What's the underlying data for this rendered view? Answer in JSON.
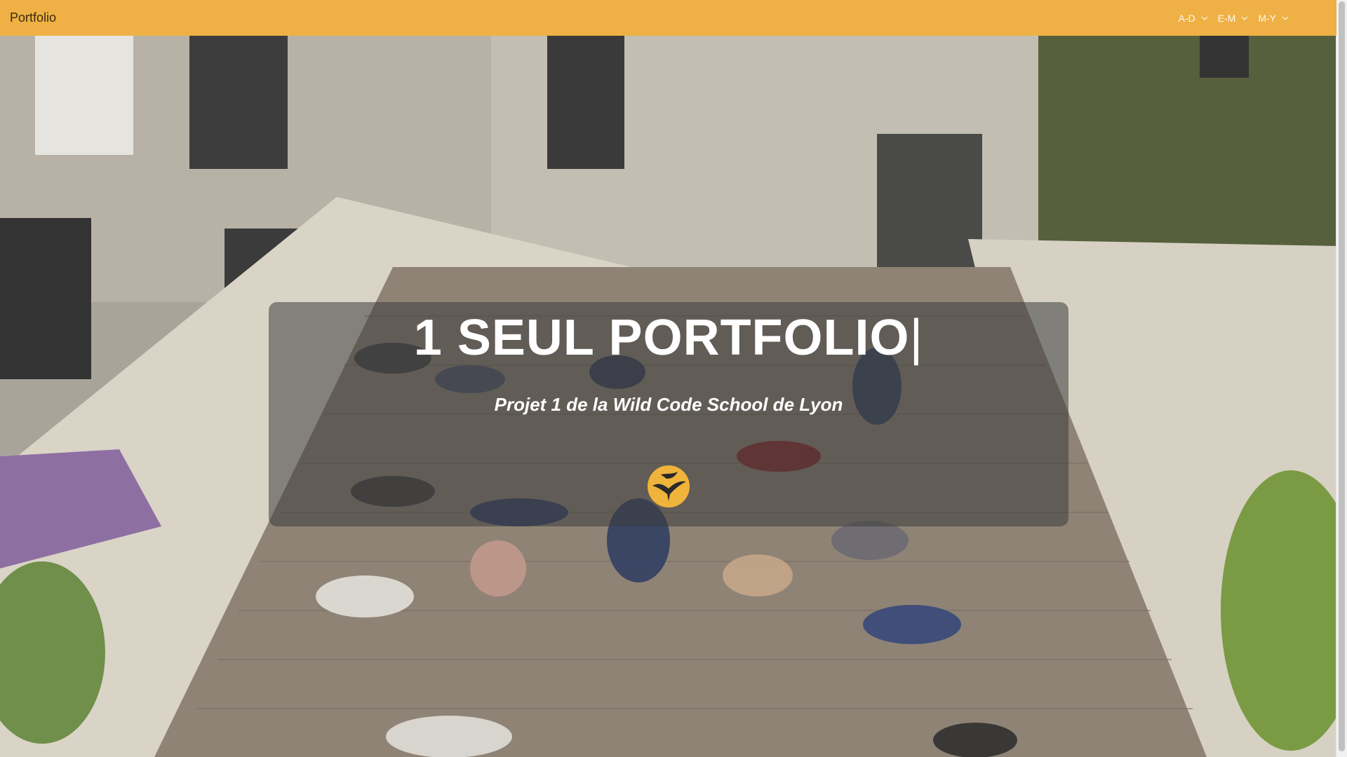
{
  "navbar": {
    "brand": "Portfolio",
    "menu": [
      {
        "label": "A-D",
        "icon": "chevron-down-icon"
      },
      {
        "label": "E-M",
        "icon": "chevron-down-icon"
      },
      {
        "label": "M-Y",
        "icon": "chevron-down-icon"
      }
    ]
  },
  "hero": {
    "title": "1 SEUL PORTFOLIO",
    "cursor": "|",
    "subtitle": "Projet 1 de la Wild Code School de Lyon",
    "logo_icon": "wild-code-school-logo-icon"
  },
  "colors": {
    "navbar_bg": "#efb145",
    "logo_bg": "#f0b43c",
    "card_overlay": "rgba(60,60,60,0.55)"
  }
}
